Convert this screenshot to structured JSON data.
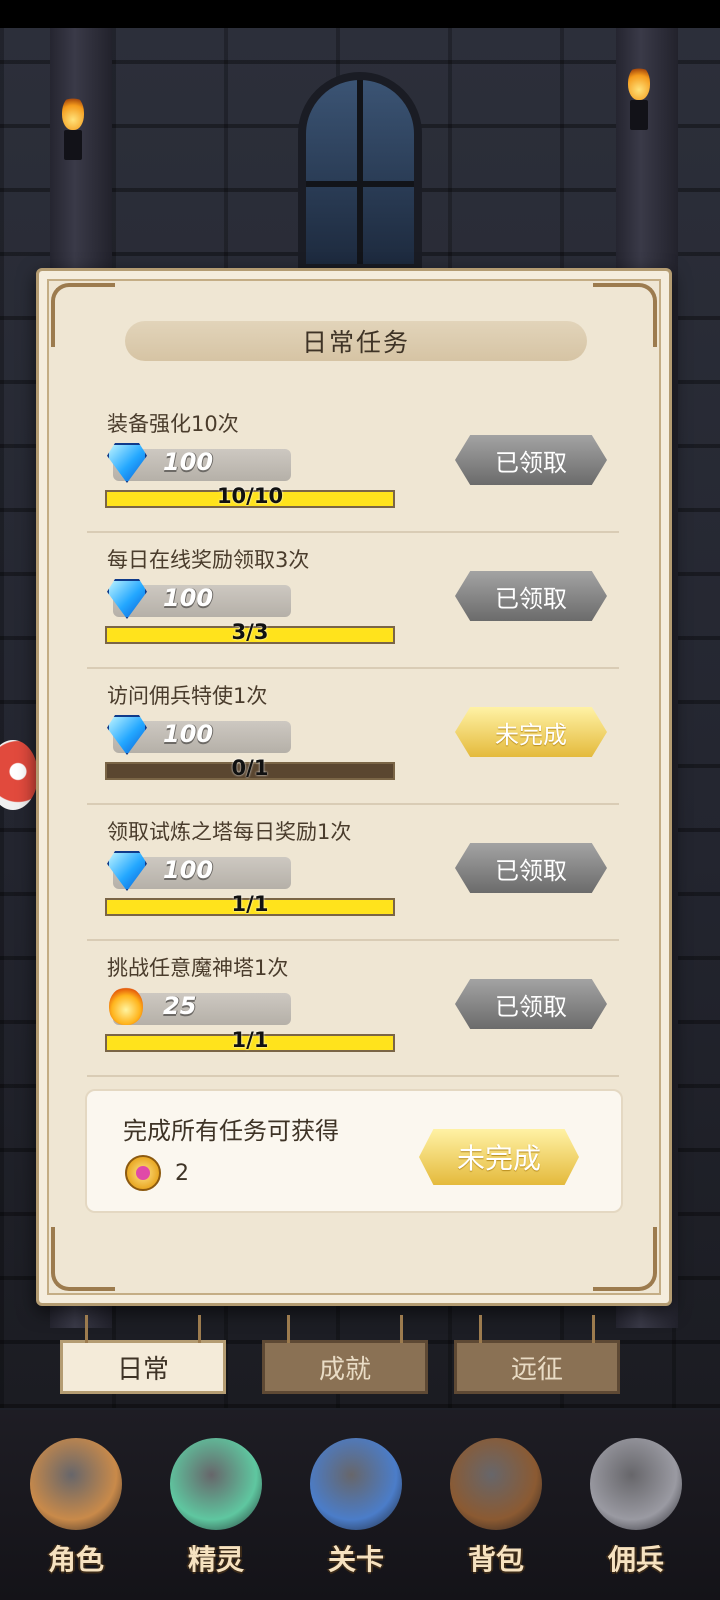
{
  "panel": {
    "title": "日常任务"
  },
  "tasks": [
    {
      "title": "装备强化10次",
      "reward_icon": "diamond-icon",
      "reward_amount": "100",
      "progress_text": "10/10",
      "progress": 1.0,
      "status": "已领取",
      "status_type": "claimed"
    },
    {
      "title": "每日在线奖励领取3次",
      "reward_icon": "diamond-icon",
      "reward_amount": "100",
      "progress_text": "3/3",
      "progress": 1.0,
      "status": "已领取",
      "status_type": "claimed"
    },
    {
      "title": "访问佣兵特使1次",
      "reward_icon": "diamond-icon",
      "reward_amount": "100",
      "progress_text": "0/1",
      "progress": 0.0,
      "status": "未完成",
      "status_type": "incomplete"
    },
    {
      "title": "领取试炼之塔每日奖励1次",
      "reward_icon": "diamond-icon",
      "reward_amount": "100",
      "progress_text": "1/1",
      "progress": 1.0,
      "status": "已领取",
      "status_type": "claimed"
    },
    {
      "title": "挑战任意魔神塔1次",
      "reward_icon": "fireball-icon",
      "reward_amount": "25",
      "progress_text": "1/1",
      "progress": 1.0,
      "status": "已领取",
      "status_type": "claimed"
    }
  ],
  "bonus": {
    "text": "完成所有任务可获得",
    "count": "2",
    "icon": "coin-icon",
    "button": "未完成"
  },
  "tabs": [
    {
      "label": "日常",
      "active": true
    },
    {
      "label": "成就",
      "active": false
    },
    {
      "label": "远征",
      "active": false
    }
  ],
  "nav": [
    {
      "label": "角色",
      "icon": "character-icon",
      "color": "#c98a4a"
    },
    {
      "label": "精灵",
      "icon": "spirit-icon",
      "color": "#5fc7a0"
    },
    {
      "label": "关卡",
      "icon": "stage-icon",
      "color": "#4b7dc9"
    },
    {
      "label": "背包",
      "icon": "backpack-icon",
      "color": "#8b5a32"
    },
    {
      "label": "佣兵",
      "icon": "mercenary-icon",
      "color": "#9a9aa2"
    }
  ],
  "colors": {
    "progress_fill": "#ffe31c",
    "button_claimed": "#8a8a8a",
    "button_incomplete": "#f2d25c",
    "paper": "#efe6d3"
  }
}
